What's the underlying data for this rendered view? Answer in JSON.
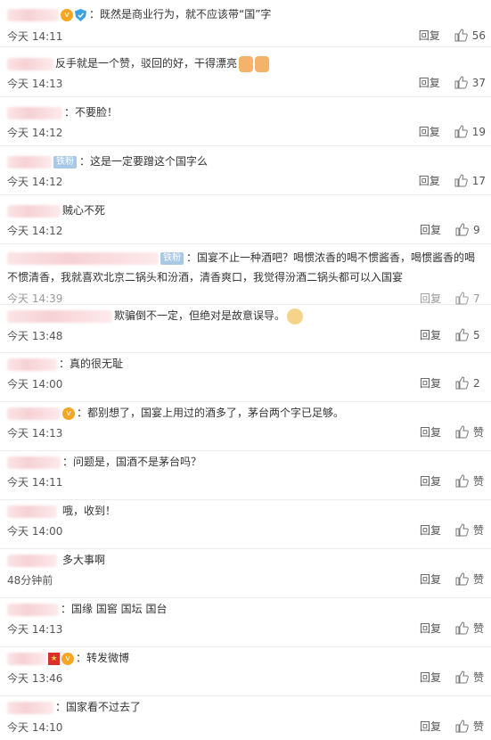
{
  "comments": [
    {
      "text": "：既然是商业行为，就不应该带“国”字",
      "time": "今天 14:11",
      "reply": "回复",
      "likes": "56"
    },
    {
      "text": "反手就是一个赞，驳回的好，干得漂亮",
      "time": "今天 14:13",
      "reply": "回复",
      "likes": "37"
    },
    {
      "text": "：不要脸！",
      "time": "今天 14:12",
      "reply": "回复",
      "likes": "19"
    },
    {
      "badge": "铁粉",
      "text": "：这是一定要蹭这个国字么",
      "time": "今天 14:12",
      "reply": "回复",
      "likes": "17"
    },
    {
      "text": "贼心不死",
      "time": "今天 14:12",
      "reply": "回复",
      "likes": "9"
    },
    {
      "badge": "铁粉",
      "text": "：国宴不止一种酒吧？喝惯浓香的喝不惯酱香，喝惯酱香的喝不惯清香，我就喜欢北京二锅头和汾酒，清香爽口，我觉得汾酒二锅头都可以入国宴",
      "time": "今天 14:39",
      "reply": "回复",
      "likes": "7"
    },
    {
      "text": "欺骗倒不一定，但绝对是故意误导。",
      "time": "今天 13:48",
      "reply": "回复",
      "likes": "5"
    },
    {
      "text": "：真的很无耻",
      "time": "今天 14:00",
      "reply": "回复",
      "likes": "2"
    },
    {
      "text": "：都别想了，国宴上用过的酒多了，茅台两个字已足够。",
      "time": "今天 14:13",
      "reply": "回复",
      "likes": "赞"
    },
    {
      "text": "：问题是，国酒不是茅台吗？",
      "time": "今天 14:11",
      "reply": "回复",
      "likes": "赞"
    },
    {
      "text": "哦，收到！",
      "time": "今天 14:00",
      "reply": "回复",
      "likes": "赞"
    },
    {
      "text": "多大事啊",
      "time": "48分钟前",
      "reply": "回复",
      "likes": "赞"
    },
    {
      "text": "：国缘 国窖 国坛  国台",
      "time": "今天 14:13",
      "reply": "回复",
      "likes": "赞"
    },
    {
      "text": "：转发微博",
      "time": "今天 13:46",
      "reply": "回复",
      "likes": "赞"
    },
    {
      "text": "：国家看不过去了",
      "time": "今天 14:10",
      "reply": "回复",
      "likes": "赞"
    }
  ],
  "icons": {
    "like": "thumbs-up-icon",
    "verified": "shield-icon",
    "vip": "vip-badge-icon"
  },
  "colors": {
    "badge": "#a8c9e6",
    "divider": "#ececec",
    "text": "#333333"
  }
}
